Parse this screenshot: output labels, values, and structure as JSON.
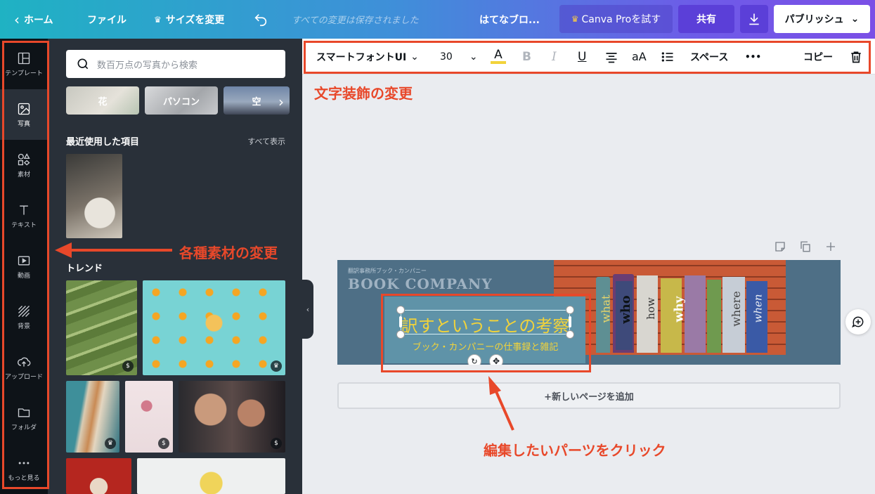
{
  "topbar": {
    "home": "ホーム",
    "file": "ファイル",
    "resize": "サイズを変更",
    "saved": "すべての変更は保存されました",
    "doc_title": "はてなブロ...",
    "try_pro": "Canva Proを試す",
    "share": "共有",
    "publish": "パブリッシュ"
  },
  "rail": {
    "items": [
      {
        "label": "テンプレート",
        "icon": "layout-icon"
      },
      {
        "label": "写真",
        "icon": "photo-icon"
      },
      {
        "label": "素材",
        "icon": "shapes-icon"
      },
      {
        "label": "テキスト",
        "icon": "text-icon"
      },
      {
        "label": "動画",
        "icon": "video-icon"
      },
      {
        "label": "背景",
        "icon": "background-icon"
      },
      {
        "label": "アップロード",
        "icon": "upload-icon"
      },
      {
        "label": "フォルダ",
        "icon": "folder-icon"
      },
      {
        "label": "もっと見る",
        "icon": "more-icon"
      }
    ]
  },
  "panel": {
    "search_placeholder": "数百万点の写真から検索",
    "chips": [
      "花",
      "パソコン",
      "空"
    ],
    "recent_title": "最近使用した項目",
    "see_all": "すべて表示",
    "trend_title": "トレンド",
    "badges": {
      "paid": "$",
      "pro": "♛"
    }
  },
  "toolbar": {
    "font": "スマートフォントUI",
    "size": "30",
    "text_color_label": "A",
    "bold": "B",
    "italic": "I",
    "underline": "U",
    "case": "aA",
    "spacing": "スペース",
    "more": "•••",
    "copy": "コピー"
  },
  "design": {
    "small_caption": "翻訳事務所ブック・カンパニー",
    "company": "BOOK COMPANY",
    "headline": "訳すということの考察",
    "subline": "ブック・カンパニーの仕事録と雑記",
    "spines": [
      "what",
      "who",
      "how",
      "why",
      "",
      "where",
      "when"
    ]
  },
  "canvas": {
    "add_page": "+新しいページを追加"
  },
  "annotations": {
    "text_style": "文字装飾の変更",
    "materials": "各種素材の変更",
    "click_part": "編集したいパーツをクリック"
  },
  "colors": {
    "accent_annotation": "#e8482a",
    "highlight_yellow": "#f2d33a",
    "panel_bg": "#293039",
    "rail_bg": "#0e1318"
  }
}
